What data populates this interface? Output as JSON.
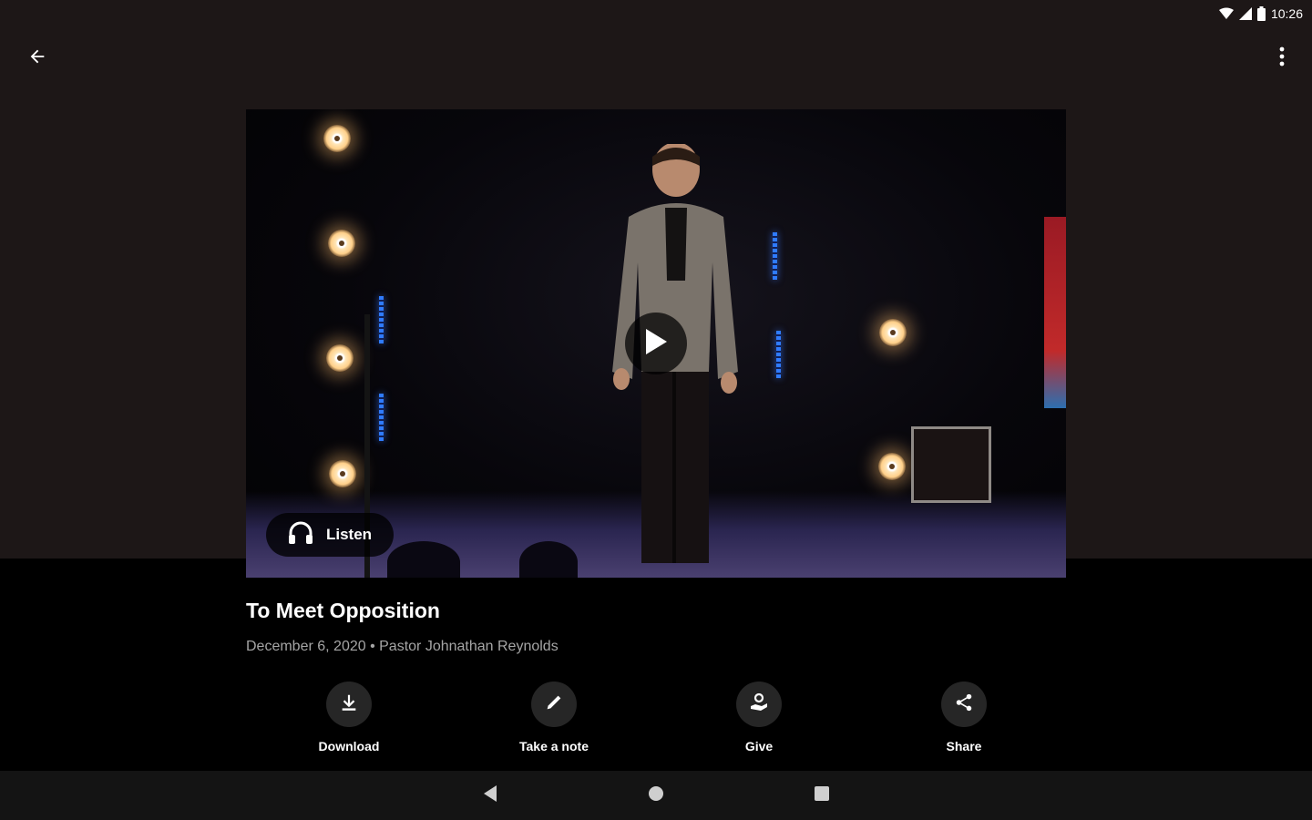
{
  "status_bar": {
    "time": "10:26",
    "icons": [
      "wifi-icon",
      "signal-icon",
      "battery-icon"
    ]
  },
  "header": {
    "back_icon": "arrow-left-icon",
    "menu_icon": "more-vert-icon"
  },
  "video": {
    "play_icon": "play-icon",
    "listen_label": "Listen",
    "listen_icon": "headphones-icon"
  },
  "sermon": {
    "title": "To Meet Opposition",
    "meta": "December 6, 2020 • Pastor Johnathan Reynolds"
  },
  "actions": [
    {
      "label": "Download",
      "icon": "download-icon"
    },
    {
      "label": "Take a note",
      "icon": "pencil-icon"
    },
    {
      "label": "Give",
      "icon": "give-icon"
    },
    {
      "label": "Share",
      "icon": "share-icon"
    }
  ],
  "nav": {
    "icons": [
      "nav-back-icon",
      "nav-home-icon",
      "nav-recents-icon"
    ]
  },
  "colors": {
    "top_background": "#1d1717",
    "content_background": "#000000",
    "nav_background": "#141414",
    "action_circle": "#262626",
    "meta_text": "#a5a5a5"
  }
}
